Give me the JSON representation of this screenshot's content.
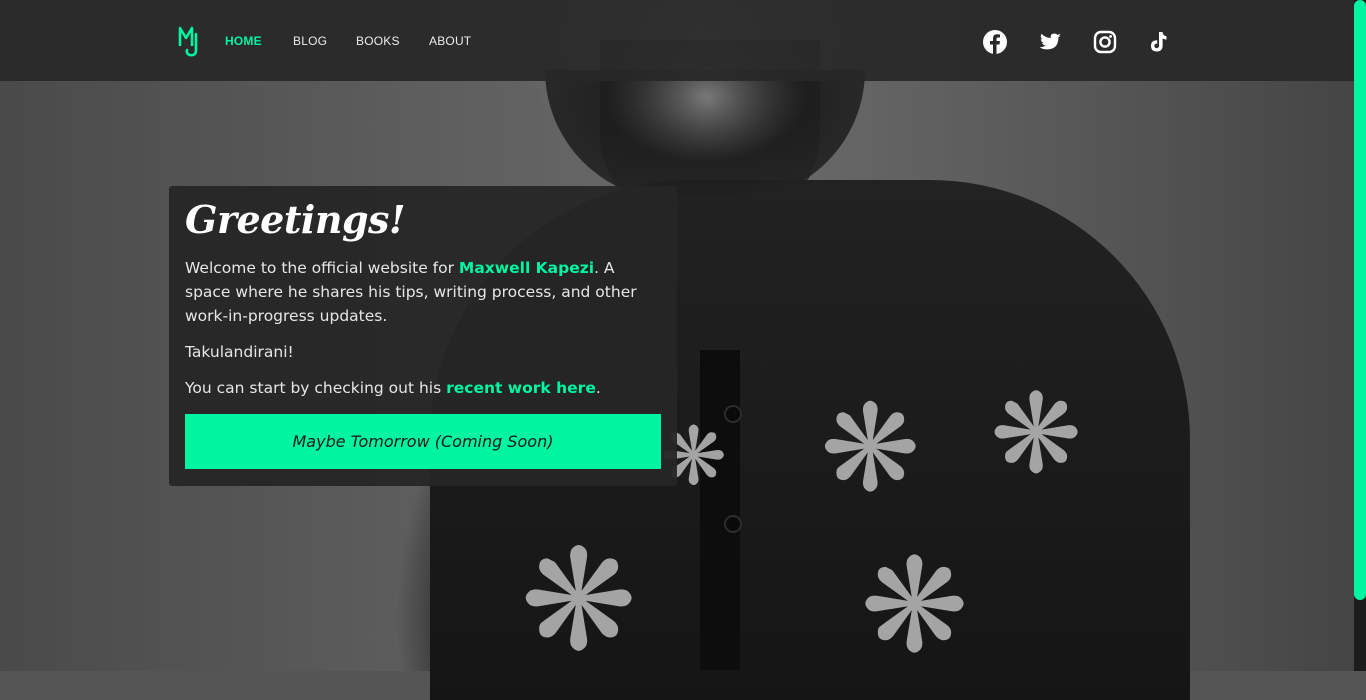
{
  "nav": {
    "logo_text": "MJ",
    "links": [
      "HOME",
      "BLOG",
      "BOOKS",
      "ABOUT"
    ],
    "active_index": 0,
    "social": [
      {
        "icon": "facebook-icon"
      },
      {
        "icon": "twitter-icon"
      },
      {
        "icon": "instagram-icon"
      },
      {
        "icon": "tiktok-icon"
      }
    ]
  },
  "greeting": {
    "title": "Greetings!",
    "intro_prefix": "Welcome to the official website for ",
    "intro_name": "Maxwell Kapezi",
    "intro_suffix": ". A space where he shares his tips, writing process, and other work-in-progress updates.",
    "salutation": "Takulandirani!",
    "recent_prefix": "You can start by checking out his ",
    "recent_link": "recent work here",
    "recent_suffix": ".",
    "cta_label": "Maybe Tomorrow (Coming Soon)"
  },
  "colors": {
    "accent": "#00f5a0",
    "navbar_bg": "#282828",
    "card_bg": "#262626"
  }
}
